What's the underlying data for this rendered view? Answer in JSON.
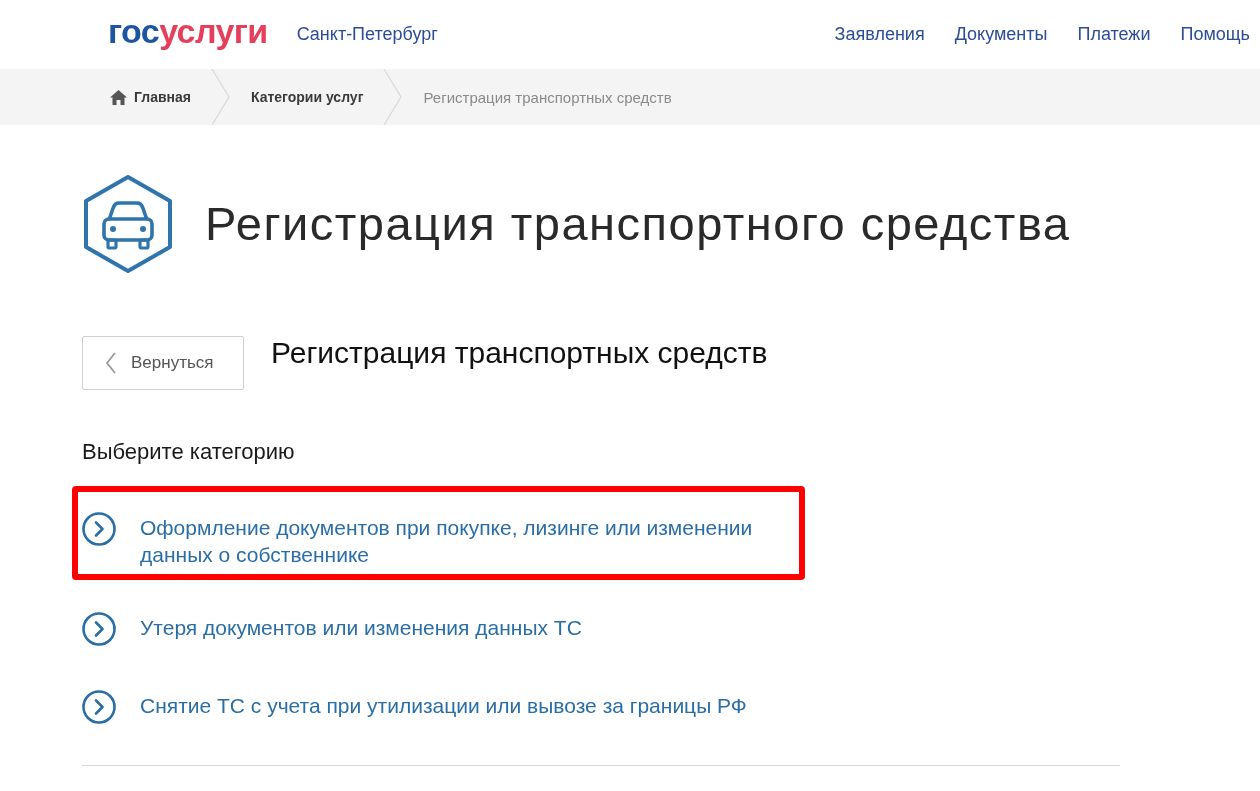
{
  "header": {
    "logo": {
      "part_1": "гос",
      "part_2": "услуги"
    },
    "region": "Санкт-Петербург",
    "nav": [
      {
        "label": "Заявления"
      },
      {
        "label": "Документы"
      },
      {
        "label": "Платежи"
      },
      {
        "label": "Помощь"
      }
    ]
  },
  "breadcrumbs": [
    {
      "label": "Главная",
      "kind": "home"
    },
    {
      "label": "Категории услуг",
      "kind": "link"
    },
    {
      "label": "Регистрация транспортных средств",
      "kind": "current"
    }
  ],
  "page": {
    "title": "Регистрация транспортного средства",
    "back_button": "Вернуться",
    "subtitle": "Регистрация транспортных средств",
    "prompt": "Выберите категорию",
    "categories": [
      {
        "label": "Оформление документов при покупке, лизинге или изменении данных о собственнике",
        "highlighted": true
      },
      {
        "label": "Утеря документов или изменения данных ТС",
        "highlighted": false
      },
      {
        "label": "Снятие ТС с учета при утилизации или вывозе за границы РФ",
        "highlighted": false
      }
    ]
  }
}
